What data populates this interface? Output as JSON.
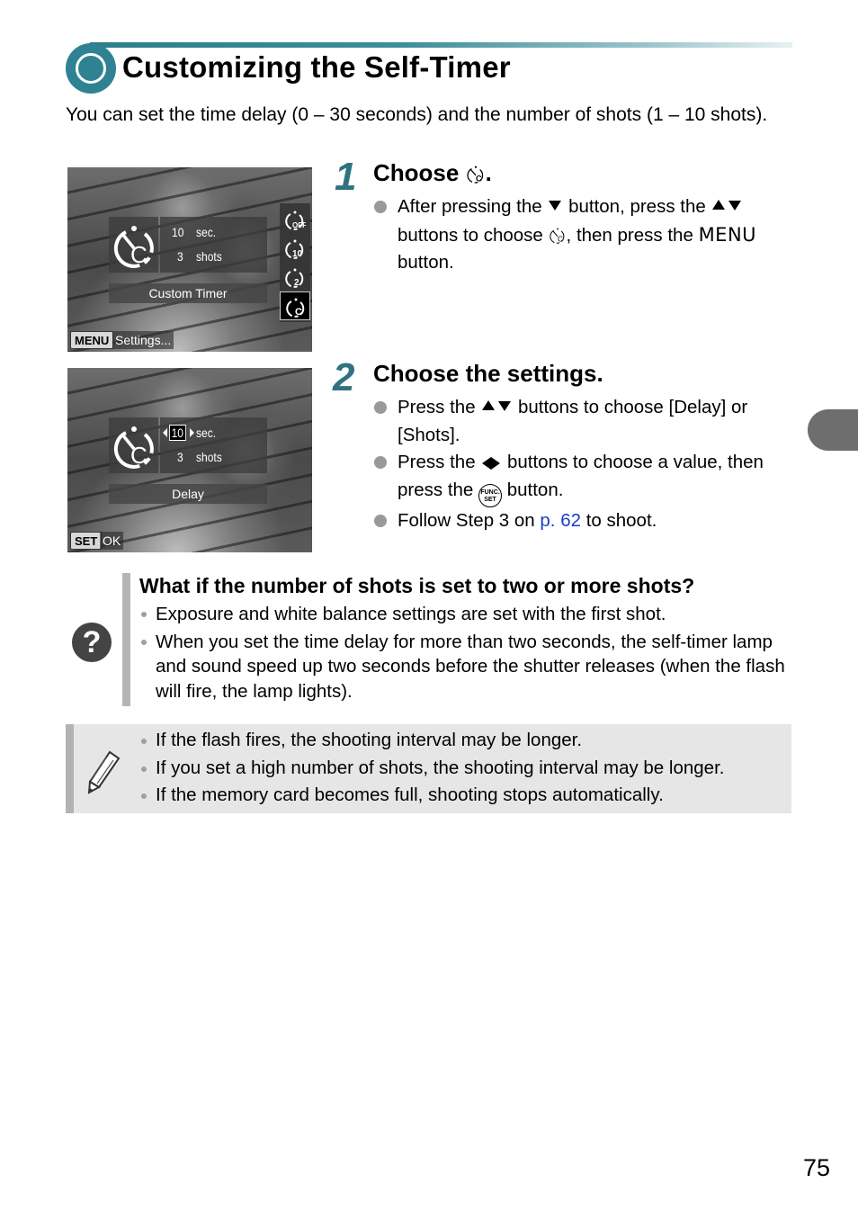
{
  "page": {
    "title": "Customizing the Self-Timer",
    "intro": "You can set the time delay (0 – 30 seconds) and the number of shots (1 – 10 shots).",
    "page_number": "75",
    "colors": {
      "accent": "#2f8291",
      "step_number": "#2f7280",
      "link": "#1a3ccc",
      "note_bg": "#e6e6e6",
      "side_tab": "#6e6e6e"
    }
  },
  "screens": [
    {
      "delay_value": "10",
      "delay_unit": "sec.",
      "shots_value": "3",
      "shots_unit": "shots",
      "label": "Custom Timer",
      "footer_key": "MENU",
      "footer_text": "Settings...",
      "side_menu": [
        "timer-off-icon",
        "timer-10-icon",
        "timer-2-icon",
        "timer-custom-icon"
      ],
      "side_menu_labels": [
        "OFF",
        "10",
        "2",
        "C"
      ],
      "selected_side_item": "timer-custom-icon"
    },
    {
      "delay_value": "10",
      "delay_unit": "sec.",
      "shots_value": "3",
      "shots_unit": "shots",
      "label": "Delay",
      "footer_key": "SET",
      "footer_text": "OK"
    }
  ],
  "steps": [
    {
      "number": "1",
      "heading_prefix": "Choose ",
      "heading_icon": "custom-timer-icon",
      "heading_suffix": ".",
      "bullets": [
        {
          "parts": [
            "After pressing the ",
            " button, press the ",
            " buttons to choose ",
            ", then press the ",
            " button."
          ],
          "menu_word": "MENU"
        }
      ]
    },
    {
      "number": "2",
      "heading": "Choose the settings.",
      "bullets": [
        {
          "parts": [
            "Press the ",
            " buttons to choose [Delay] or [Shots]."
          ]
        },
        {
          "parts": [
            "Press the ",
            " buttons to choose a value, then press the ",
            " button."
          ],
          "func_label_top": "FUNC.",
          "func_label_bottom": "SET"
        },
        {
          "parts": [
            "Follow Step 3 on ",
            " to shoot."
          ],
          "link": "p. 62"
        }
      ]
    }
  ],
  "qa": {
    "icon": "question-icon",
    "title": "What if the number of shots is set to two or more shots?",
    "items": [
      "Exposure and white balance settings are set with the first shot.",
      "When you set the time delay for more than two seconds, the self-timer lamp and sound speed up two seconds before the shutter releases (when the flash will fire, the lamp lights)."
    ]
  },
  "note": {
    "icon": "pencil-icon",
    "items": [
      "If the flash fires, the shooting interval may be longer.",
      "If you set a high number of shots, the shooting interval may be longer.",
      "If the memory card becomes full, shooting stops automatically."
    ]
  }
}
